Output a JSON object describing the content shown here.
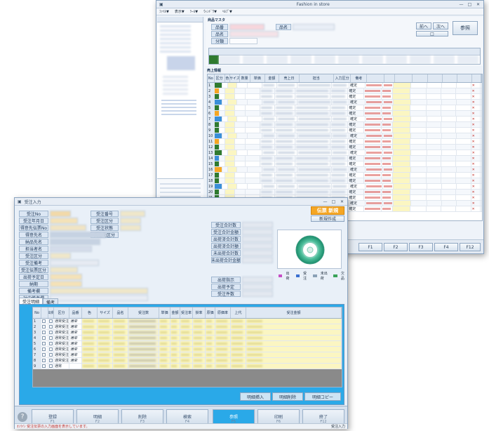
{
  "back_window": {
    "title": "Fashion in store",
    "menu": [
      "ﾌｧｲﾙ▼",
      "表示▼",
      "ﾂｰﾙ▼",
      "ｳｨﾝﾄﾞｳ▼",
      "ﾍﾙﾌﾟ▼"
    ],
    "section_product": "商品マスタ",
    "section_sales": "売上情報",
    "labels_top": [
      "品番",
      "品名",
      "分類"
    ],
    "nav_buttons": [
      "前へ",
      "次へ",
      "参照"
    ],
    "grid_header": [
      "No",
      "区分",
      "色",
      "サイズ",
      "数量",
      "単価",
      "金額",
      "売上日",
      "担当",
      "入力区分",
      "備考"
    ],
    "row_numbers": [
      "1",
      "2",
      "3",
      "4",
      "5",
      "6",
      "7",
      "8",
      "9",
      "10",
      "11",
      "12",
      "13",
      "14",
      "15",
      "16",
      "17",
      "18",
      "19",
      "20",
      "21",
      "22",
      "23"
    ],
    "status_cell": "確定",
    "bottom_buttons": [
      "F1",
      "F2",
      "F3",
      "F4",
      "F12"
    ]
  },
  "front_window": {
    "title": "受注入力",
    "mode_button": "伝票 新規",
    "mode_button_sub": "新規作成",
    "left_labels": [
      "受注No",
      "受注年月日",
      "得意先伝票No",
      "得意先名",
      "納品先名",
      "担当者名",
      "受注区分",
      "受注備考",
      "受注伝票区分",
      "出荷予定日",
      "納期",
      "備考欄",
      "社内備考欄"
    ],
    "mid_labels": [
      "受注番号",
      "受注区分",
      "受注状態",
      "受注先区分"
    ],
    "right_labels": [
      "受注合計数",
      "受注合計金額",
      "出荷済合計数",
      "出荷済合計額",
      "未出荷合計数",
      "未出荷合計金額"
    ],
    "right_labels_lower": [
      "出荷指示",
      "出荷予定",
      "受注件数"
    ],
    "legend": [
      "出荷",
      "受注",
      "未出荷",
      "欠品"
    ],
    "tabs": [
      "受注明細",
      "備考"
    ],
    "grid_header": [
      "No",
      "",
      "出荷",
      "区分",
      "品番",
      "色",
      "サイズ",
      "品名",
      "受注数",
      "単価",
      "金額",
      "受注率",
      "掛率",
      "原価",
      "原価率",
      "上代",
      "受注金額"
    ],
    "rows": [
      {
        "no": "1",
        "kubun": "通常受注",
        "tanto": "通常"
      },
      {
        "no": "2",
        "kubun": "通常受注",
        "tanto": "通常"
      },
      {
        "no": "3",
        "kubun": "通常受注",
        "tanto": "通常"
      },
      {
        "no": "4",
        "kubun": "通常受注",
        "tanto": "通常"
      },
      {
        "no": "5",
        "kubun": "通常受注",
        "tanto": "通常"
      },
      {
        "no": "6",
        "kubun": "通常受注",
        "tanto": "通常"
      },
      {
        "no": "7",
        "kubun": "通常受注",
        "tanto": "通常"
      },
      {
        "no": "8",
        "kubun": "通常受注",
        "tanto": "通常"
      },
      {
        "no": "9",
        "kubun": "通常",
        "tanto": ""
      }
    ],
    "grid_buttons": [
      "明細挿入",
      "明細削除",
      "明細コピー"
    ],
    "function_buttons": [
      {
        "label": "F1",
        "sub": "登録"
      },
      {
        "label": "F2",
        "sub": "明細"
      },
      {
        "label": "F3",
        "sub": "削除"
      },
      {
        "label": "F4",
        "sub": "検索"
      },
      {
        "label": "F5",
        "sub": "参照"
      },
      {
        "label": "F6",
        "sub": "印刷"
      },
      {
        "label": "F12",
        "sub": "終了"
      }
    ],
    "status_text": "ｵﾝﾗｲﾝ 受注伝票の入力画面を表示しています。",
    "status_right": "受注入力"
  },
  "colors": {
    "accent_orange": "#f5a623",
    "header_blue": "#dfe8f3",
    "highlight_yellow": "#fbf6c2"
  }
}
